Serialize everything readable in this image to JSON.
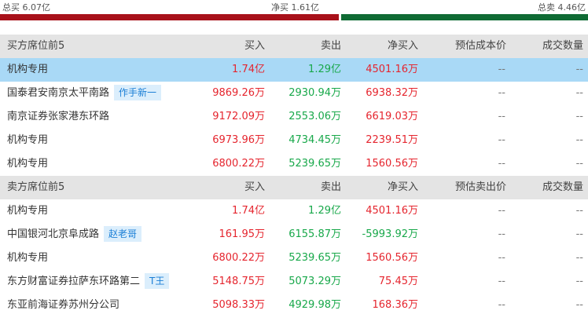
{
  "summary": {
    "total_buy": "总买 6.07亿",
    "net_buy": "净买 1.61亿",
    "total_sell": "总卖 4.46亿"
  },
  "colors": {
    "buy_bar": "#a8111a",
    "sell_bar": "#0f6b34",
    "highlight": "#a9d9f6",
    "header_bg": "#e4e4e4"
  },
  "buy_section": {
    "header": {
      "name": "买方席位前5",
      "buy": "买入",
      "sell": "卖出",
      "net": "净买入",
      "est": "预估成本价",
      "qty": "成交数量"
    },
    "rows": [
      {
        "name": "机构专用",
        "tag": "",
        "buy": "1.74亿",
        "sell": "1.29亿",
        "net": "4501.16万",
        "est": "--",
        "qty": "--"
      },
      {
        "name": "国泰君安南京太平南路",
        "tag": "作手新一",
        "buy": "9869.26万",
        "sell": "2930.94万",
        "net": "6938.32万",
        "est": "--",
        "qty": "--"
      },
      {
        "name": "南京证券张家港东环路",
        "tag": "",
        "buy": "9172.09万",
        "sell": "2553.06万",
        "net": "6619.03万",
        "est": "--",
        "qty": "--"
      },
      {
        "name": "机构专用",
        "tag": "",
        "buy": "6973.96万",
        "sell": "4734.45万",
        "net": "2239.51万",
        "est": "--",
        "qty": "--"
      },
      {
        "name": "机构专用",
        "tag": "",
        "buy": "6800.22万",
        "sell": "5239.65万",
        "net": "1560.56万",
        "est": "--",
        "qty": "--"
      }
    ]
  },
  "sell_section": {
    "header": {
      "name": "卖方席位前5",
      "buy": "买入",
      "sell": "卖出",
      "net": "净买入",
      "est": "预估卖出价",
      "qty": "成交数量"
    },
    "rows": [
      {
        "name": "机构专用",
        "tag": "",
        "buy": "1.74亿",
        "sell": "1.29亿",
        "net": "4501.16万",
        "est": "--",
        "qty": "--"
      },
      {
        "name": "中国银河北京阜成路",
        "tag": "赵老哥",
        "buy": "161.95万",
        "sell": "6155.87万",
        "net": "-5993.92万",
        "est": "--",
        "qty": "--"
      },
      {
        "name": "机构专用",
        "tag": "",
        "buy": "6800.22万",
        "sell": "5239.65万",
        "net": "1560.56万",
        "est": "--",
        "qty": "--"
      },
      {
        "name": "东方财富证券拉萨东环路第二",
        "tag": "T王",
        "buy": "5148.75万",
        "sell": "5073.29万",
        "net": "75.45万",
        "est": "--",
        "qty": "--"
      },
      {
        "name": "东亚前海证券苏州分公司",
        "tag": "",
        "buy": "5098.33万",
        "sell": "4929.98万",
        "net": "168.36万",
        "est": "--",
        "qty": "--"
      }
    ]
  }
}
